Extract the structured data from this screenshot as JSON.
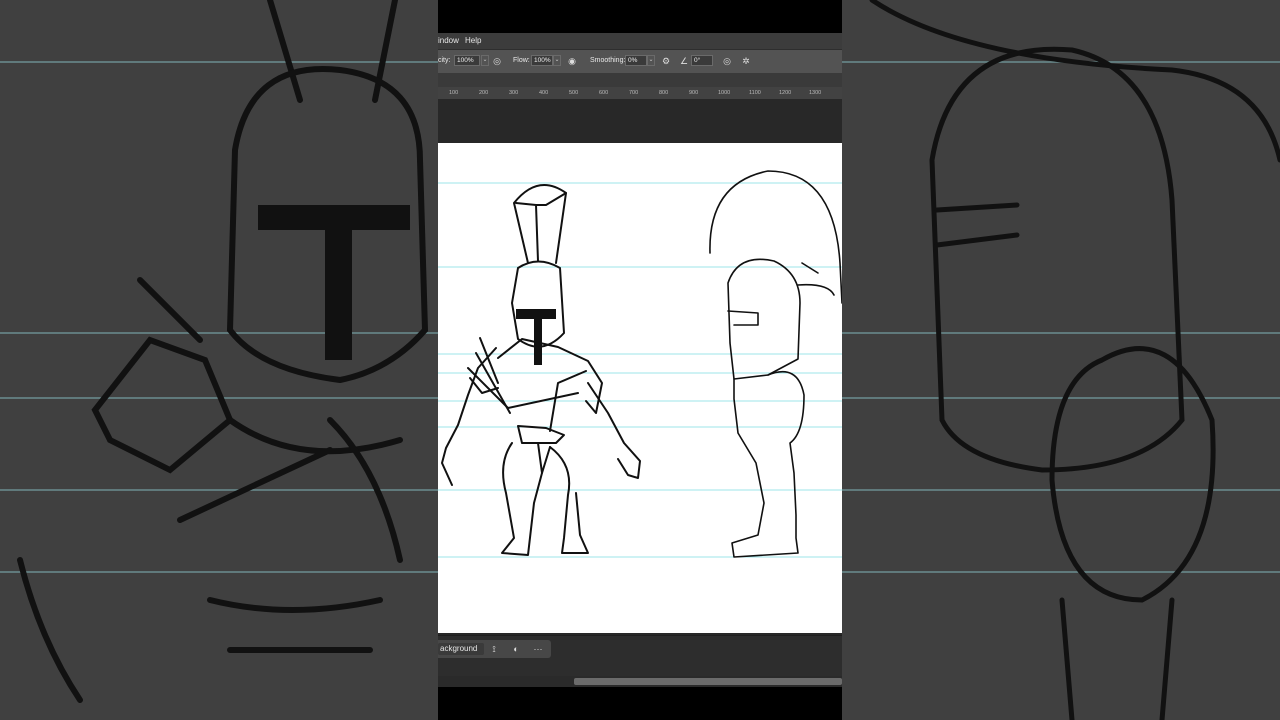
{
  "menu": {
    "window_label": "indow",
    "help_label": "Help"
  },
  "options": {
    "opacity_label": "city:",
    "opacity_value": "100%",
    "flow_label": "Flow:",
    "flow_value": "100%",
    "smoothing_label": "Smoothing:",
    "smoothing_value": "0%",
    "angle_value": "0°"
  },
  "ruler": {
    "ticks": [
      "100",
      "200",
      "300",
      "400",
      "500",
      "600",
      "700",
      "800",
      "900",
      "1000",
      "1100",
      "1200",
      "1300"
    ]
  },
  "layers": {
    "current_layer": "ackground",
    "more_label": "···"
  },
  "colors": {
    "canvas_bg": "#ffffff",
    "guide_line": "#9ee6ea",
    "ink": "#111111"
  }
}
